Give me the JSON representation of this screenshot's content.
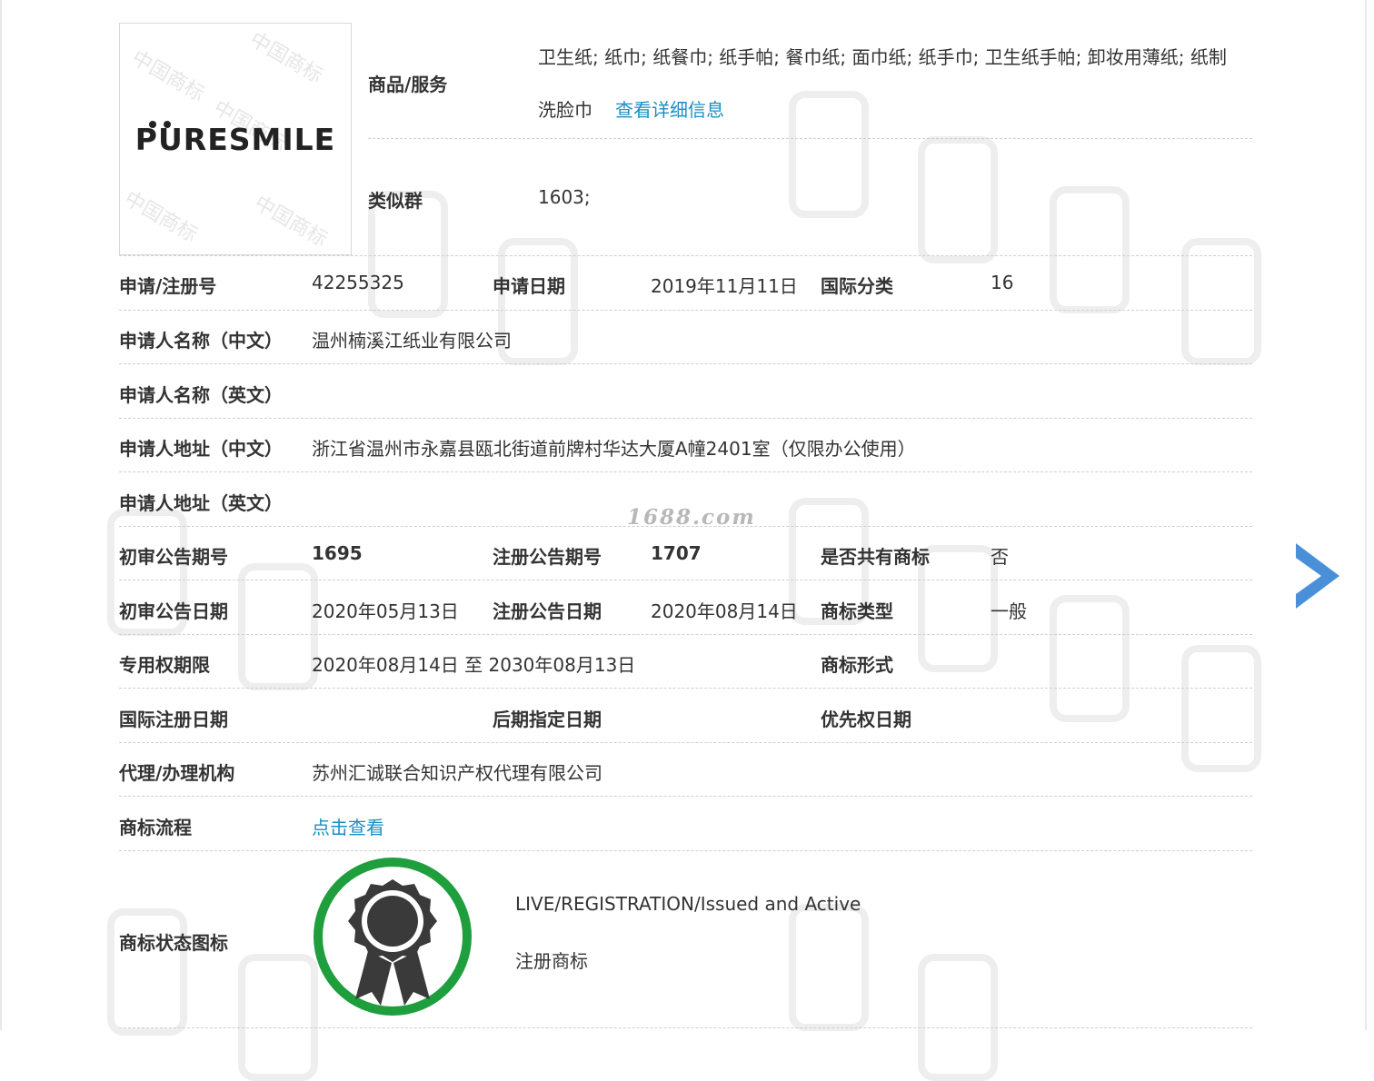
{
  "logo": {
    "brand_text": "PURESMILE",
    "watermark": "中国商标"
  },
  "goods": {
    "label": "商品/服务",
    "value_line1": "卫生纸; 纸巾; 纸餐巾; 纸手帕; 餐巾纸; 面巾纸; 纸手巾; 卫生纸手帕; 卸妆用薄纸; 纸制",
    "value_line2": "洗脸巾",
    "detail_link": "查看详细信息"
  },
  "similar_group": {
    "label": "类似群",
    "value": "1603;"
  },
  "rows": {
    "reg_no": {
      "label": "申请/注册号",
      "value": "42255325"
    },
    "app_date": {
      "label": "申请日期",
      "value": "2019年11月11日"
    },
    "intl_class": {
      "label": "国际分类",
      "value": "16"
    },
    "applicant_cn": {
      "label": "申请人名称（中文）",
      "value": "温州楠溪江纸业有限公司"
    },
    "applicant_en": {
      "label": "申请人名称（英文）",
      "value": ""
    },
    "address_cn": {
      "label": "申请人地址（中文）",
      "value": "浙江省温州市永嘉县瓯北街道前牌村华达大厦A幢2401室（仅限办公使用）"
    },
    "address_en": {
      "label": "申请人地址（英文）",
      "value": ""
    },
    "prelim_no": {
      "label": "初审公告期号",
      "value": "1695"
    },
    "reg_notice_no": {
      "label": "注册公告期号",
      "value": "1707"
    },
    "shared": {
      "label": "是否共有商标",
      "value": "否"
    },
    "prelim_date": {
      "label": "初审公告日期",
      "value": "2020年05月13日"
    },
    "reg_notice_date": {
      "label": "注册公告日期",
      "value": "2020年08月14日"
    },
    "tm_type": {
      "label": "商标类型",
      "value": "一般"
    },
    "exclusive_period": {
      "label": "专用权期限",
      "value": "2020年08月14日 至 2030年08月13日"
    },
    "tm_form": {
      "label": "商标形式",
      "value": ""
    },
    "intl_reg_date": {
      "label": "国际注册日期",
      "value": ""
    },
    "later_designation": {
      "label": "后期指定日期",
      "value": ""
    },
    "priority_date": {
      "label": "优先权日期",
      "value": ""
    },
    "agent": {
      "label": "代理/办理机构",
      "value": "苏州汇诚联合知识产权代理有限公司"
    },
    "process": {
      "label": "商标流程",
      "link": "点击查看"
    }
  },
  "status": {
    "label": "商标状态图标",
    "english": "LIVE/REGISTRATION/Issued and Active",
    "chinese": "注册商标"
  },
  "site_watermark": "1688.com",
  "colors": {
    "link": "#1a8fc6",
    "arrow": "#4a90d9",
    "badge_ring": "#1e9e3c",
    "badge": "#3a3a3a"
  }
}
